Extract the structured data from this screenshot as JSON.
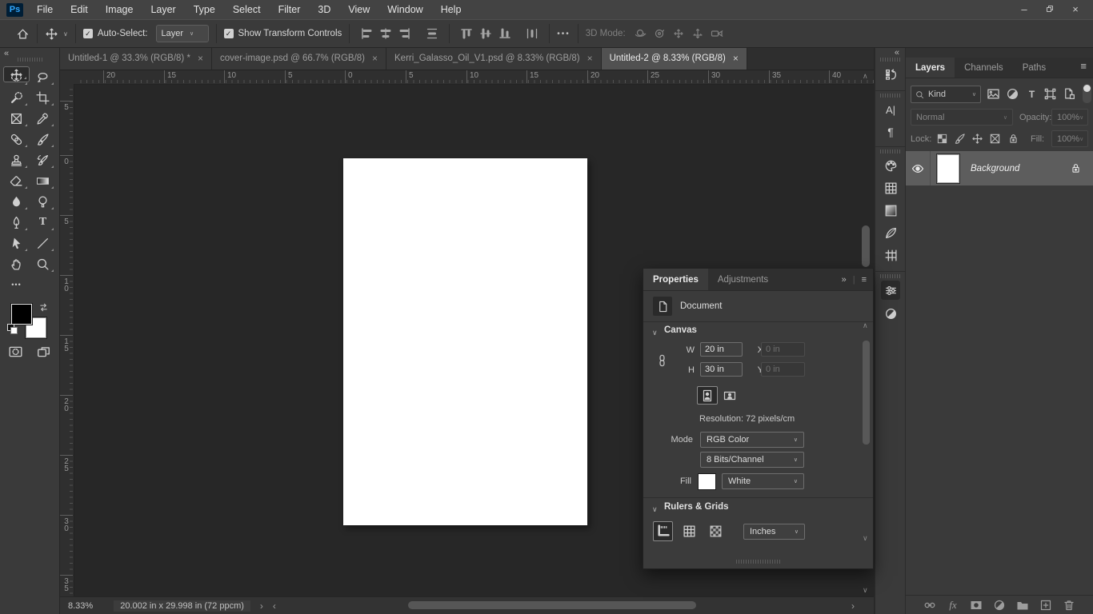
{
  "menu_bar": {
    "logo": "Ps",
    "items": [
      "File",
      "Edit",
      "Image",
      "Layer",
      "Type",
      "Select",
      "Filter",
      "3D",
      "View",
      "Window",
      "Help"
    ]
  },
  "window_controls": {
    "minimize": "–",
    "close": "×"
  },
  "options_bar": {
    "auto_select_label": "Auto-Select:",
    "auto_select_checked": true,
    "layer_dropdown_value": "Layer",
    "show_transform_label": "Show Transform Controls",
    "show_transform_checked": true,
    "more_options": "•••",
    "mode_3d_label": "3D Mode:"
  },
  "document_tabs": [
    {
      "label": "Untitled-1 @ 33.3% (RGB/8) *",
      "close": "×",
      "active": false
    },
    {
      "label": "cover-image.psd @ 66.7% (RGB/8)",
      "close": "×",
      "active": false
    },
    {
      "label": "Kerri_Galasso_Oil_V1.psd @ 8.33% (RGB/8)",
      "close": "×",
      "active": false
    },
    {
      "label": "Untitled-2 @ 8.33% (RGB/8)",
      "close": "×",
      "active": true
    }
  ],
  "toolbar": {
    "selected_tool": "move",
    "tools": [
      "move",
      "elliptical-marquee",
      "lasso",
      "quick-selection",
      "crop",
      "frame",
      "eyedropper",
      "healing-brush",
      "brush",
      "clone-stamp",
      "history-brush",
      "eraser",
      "gradient",
      "blur",
      "dodge",
      "pen",
      "type",
      "path-selection",
      "line",
      "hand",
      "zoom",
      "edit-toolbar"
    ]
  },
  "rulers": {
    "horizontal_labels": [
      "20",
      "15",
      "10",
      "5",
      "0",
      "5",
      "10",
      "15",
      "20",
      "25",
      "30",
      "35",
      "40"
    ],
    "vertical_labels": [
      "5",
      "0",
      "5",
      "10",
      "15",
      "20",
      "25",
      "30",
      "35"
    ]
  },
  "properties_panel": {
    "tabs": [
      {
        "label": "Properties",
        "active": true
      },
      {
        "label": "Adjustments",
        "active": false
      }
    ],
    "document_label": "Document",
    "canvas": {
      "title": "Canvas",
      "w_label": "W",
      "w_value": "20 in",
      "x_label": "X",
      "x_value": "0 in",
      "h_label": "H",
      "h_value": "30 in",
      "y_label": "Y",
      "y_value": "0 in",
      "resolution": "Resolution: 72 pixels/cm",
      "mode_label": "Mode",
      "mode_value": "RGB Color",
      "depth_value": "8 Bits/Channel",
      "fill_label": "Fill",
      "fill_value": "White",
      "fill_color": "#ffffff"
    },
    "rulers_grids": {
      "title": "Rulers & Grids",
      "units_value": "Inches"
    }
  },
  "layers_panel": {
    "tabs": [
      {
        "label": "Layers",
        "active": true
      },
      {
        "label": "Channels",
        "active": false
      },
      {
        "label": "Paths",
        "active": false
      }
    ],
    "kind_label": "Kind",
    "blend_mode_value": "Normal",
    "opacity_label": "Opacity:",
    "opacity_value": "100%",
    "lock_label": "Lock:",
    "fill_label": "Fill:",
    "fill_value": "100%",
    "layers": [
      {
        "name": "Background",
        "visible": true,
        "locked": true,
        "selected": true,
        "thumb_color": "#ffffff"
      }
    ]
  },
  "status_bar": {
    "zoom_level": "8.33%",
    "document_info": "20.002 in x 29.998 in (72 ppcm)"
  },
  "icons": {
    "check": "✓",
    "collapse_left": "«",
    "hamburger": "≡",
    "chevron_down": "∨",
    "chevron_up": "∧",
    "chevron_left": "‹",
    "chevron_right": "›",
    "panel_expand": "»",
    "close": "×",
    "minimize": "–",
    "paragraph": "¶",
    "ellipsis": "•••"
  },
  "colors": {
    "logo_bg": "#001e36",
    "logo_text": "#31a8ff",
    "pasteboard": "#272727",
    "panel_bg": "#3a3a3a",
    "canvas": "#ffffff",
    "selected_layer_row": "#5d5d5d"
  }
}
